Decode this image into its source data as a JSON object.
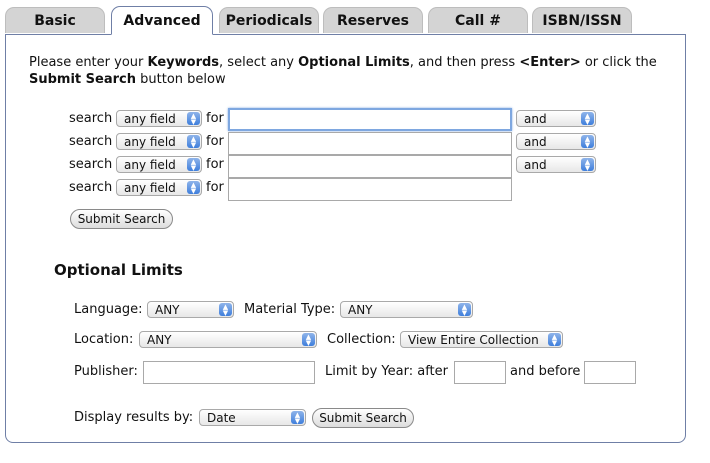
{
  "tabs": [
    {
      "label": "Basic"
    },
    {
      "label": "Advanced"
    },
    {
      "label": "Periodicals"
    },
    {
      "label": "Reserves"
    },
    {
      "label": "Call #"
    },
    {
      "label": "ISBN/ISSN"
    }
  ],
  "instructions": {
    "part1": "Please enter your ",
    "keywords": "Keywords",
    "part2": ", select any ",
    "optional_limits": "Optional Limits",
    "part3": ", and then press ",
    "enter": "<Enter>",
    "part4": " or click the ",
    "submit_search": "Submit Search",
    "part5": " button below"
  },
  "search_rows": [
    {
      "label": "search",
      "field": "any field",
      "for": "for",
      "value": "",
      "operator": "and"
    },
    {
      "label": "search",
      "field": "any field",
      "for": "for",
      "value": "",
      "operator": "and"
    },
    {
      "label": "search",
      "field": "any field",
      "for": "for",
      "value": "",
      "operator": "and"
    },
    {
      "label": "search",
      "field": "any field",
      "for": "for",
      "value": ""
    }
  ],
  "submit_label": "Submit Search",
  "optional": {
    "heading": "Optional Limits",
    "language_label": "Language:",
    "language_value": "ANY",
    "material_label": "Material Type:",
    "material_value": "ANY",
    "location_label": "Location:",
    "location_value": "ANY",
    "collection_label": "Collection:",
    "collection_value": "View Entire Collection",
    "publisher_label": "Publisher:",
    "publisher_value": "",
    "year_label": "Limit by Year:  after",
    "after_value": "",
    "before_label": "and before",
    "before_value": "",
    "display_label": "Display results by:",
    "display_value": "Date",
    "submit_label": "Submit Search"
  },
  "colors": {
    "panel_border": "#6f7fa6",
    "tab_inactive": "#d4d4d4",
    "select_arrow": "#3f7fdc",
    "focus": "#7ea7e0"
  }
}
